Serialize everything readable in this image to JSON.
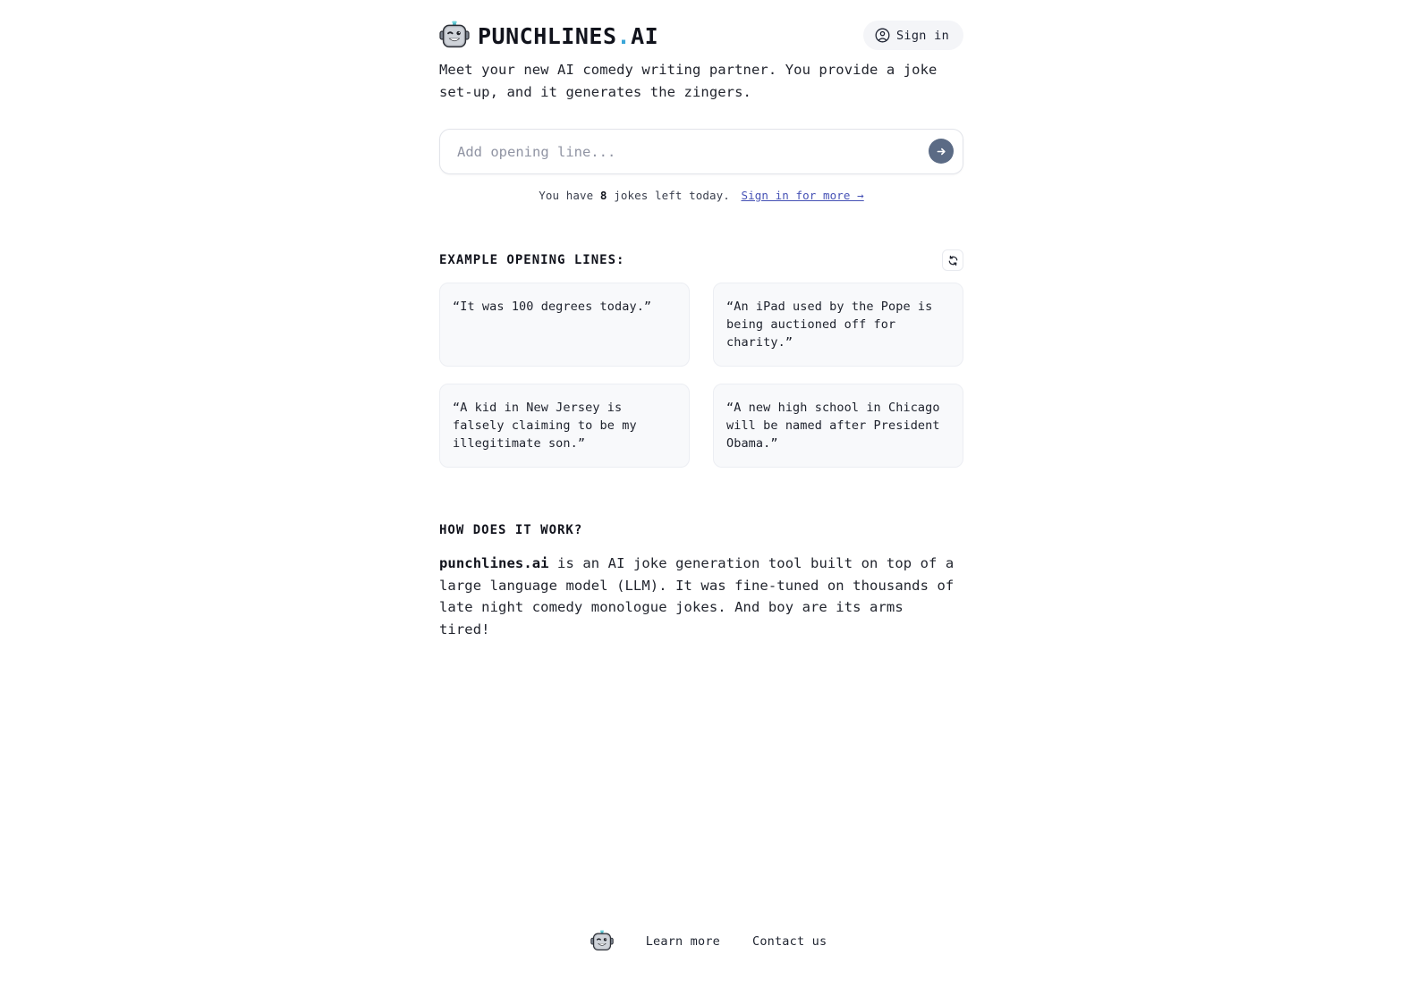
{
  "brand": {
    "logo_icon": "robot-head-icon",
    "name_main": "PUNCHLINES",
    "name_dot": ".",
    "name_suffix": "AI"
  },
  "header": {
    "signin_label": "Sign in",
    "signin_icon": "user-circle-icon"
  },
  "hero": {
    "tagline": "Meet your new AI comedy writing partner. You provide a joke set-up, and it generates the zingers."
  },
  "composer": {
    "placeholder": "Add opening line...",
    "value": "",
    "submit_icon": "arrow-right-circle-icon"
  },
  "quota": {
    "prefix": "You have",
    "count": "8",
    "suffix": "jokes left today.",
    "link_label": "Sign in for more →"
  },
  "examples": {
    "title": "EXAMPLE OPENING LINES:",
    "refresh_icon": "refresh-icon",
    "cards": [
      {
        "text": "“It was 100 degrees today.”"
      },
      {
        "text": "“An iPad used by the Pope is being auctioned off for charity.”"
      },
      {
        "text": "“A kid in New Jersey is falsely claiming to be my illegitimate son.”"
      },
      {
        "text": "“A new high school in Chicago will be named after President Obama.”"
      }
    ]
  },
  "how": {
    "title": "HOW DOES IT WORK?",
    "brand_bold": "punchlines.ai",
    "body": " is an AI joke generation tool built on top of a large language model (LLM). It was fine-tuned on thousands of late night comedy monologue jokes. And boy are its arms tired!"
  },
  "footer": {
    "logo_icon": "robot-head-icon",
    "links": [
      {
        "label": "Learn more"
      },
      {
        "label": "Contact us"
      }
    ]
  },
  "colors": {
    "accent_dot": "#3aa6d8",
    "link": "#4551b5",
    "submit_button": "#5b6b85",
    "card_bg": "#f8f9fb",
    "pill_bg": "#f4f5f8",
    "text": "#22252e"
  }
}
